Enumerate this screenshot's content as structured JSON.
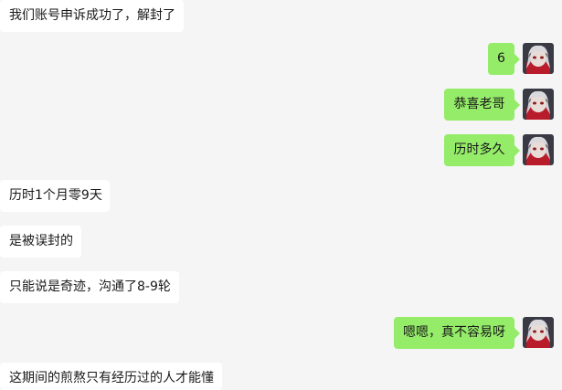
{
  "messages": [
    {
      "side": "in",
      "text": "我们账号申诉成功了，解封了"
    },
    {
      "side": "out",
      "text": "6"
    },
    {
      "side": "out",
      "text": "恭喜老哥"
    },
    {
      "side": "out",
      "text": "历时多久"
    },
    {
      "side": "in",
      "text": "历时1个月零9天"
    },
    {
      "side": "in",
      "text": "是被误封的"
    },
    {
      "side": "in",
      "text": "只能说是奇迹，沟通了8-9轮"
    },
    {
      "side": "out",
      "text": "嗯嗯，真不容易呀"
    },
    {
      "side": "in",
      "text": "这期间的煎熬只有经历过的人才能懂"
    }
  ],
  "self_avatar_icon": "anime-avatar-icon",
  "colors": {
    "background": "#f5f5f5",
    "incoming_bubble": "#ffffff",
    "outgoing_bubble": "#95ec69",
    "text": "#191919"
  }
}
